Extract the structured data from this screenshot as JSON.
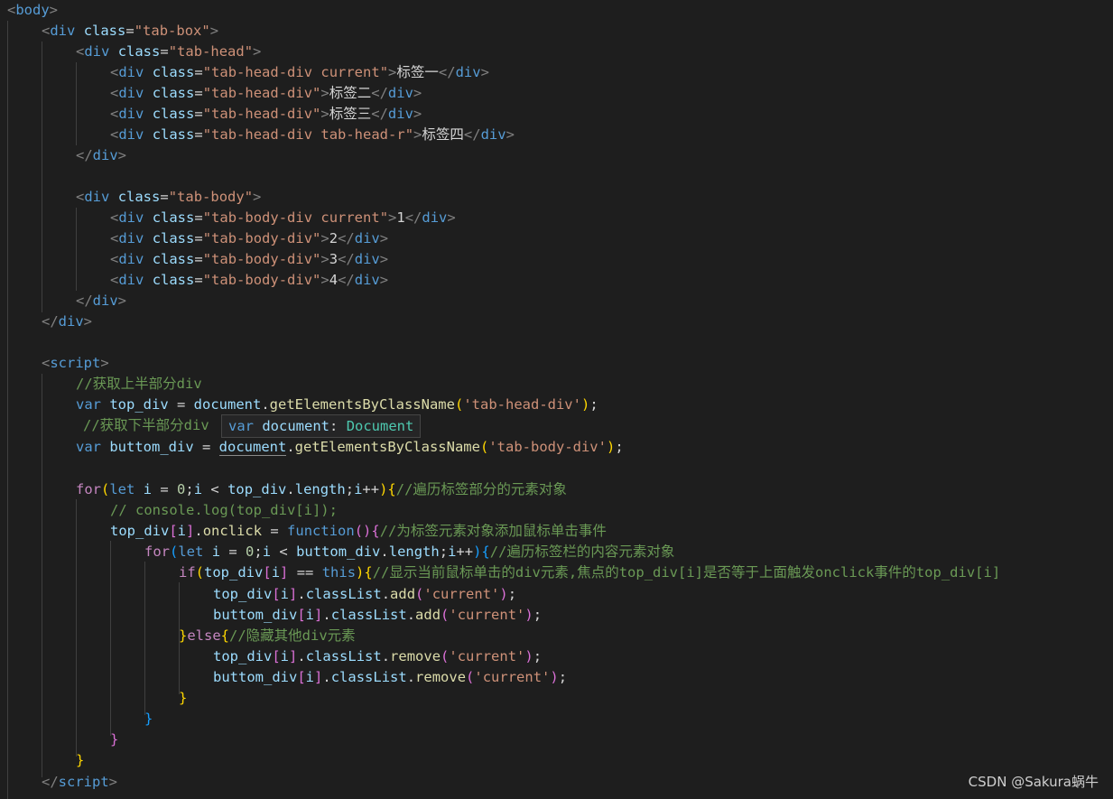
{
  "watermark": "CSDN @Sakura蜗牛",
  "hover": {
    "keyword": "var",
    "name": "document",
    "colon": ":",
    "type": "Document"
  },
  "colors": {
    "background": "#1e1e1e",
    "tag": "#569cd6",
    "attribute": "#9cdcfe",
    "string": "#ce9178",
    "comment": "#6a9955",
    "function": "#dcdcaa",
    "control_keyword": "#c586c0",
    "bracket_level1": "#ffd700",
    "bracket_level2": "#da70d6",
    "bracket_level3": "#179fff"
  },
  "code": {
    "tab_heads": [
      {
        "class_value": "tab-head-div current",
        "text": "标签一"
      },
      {
        "class_value": "tab-head-div",
        "text": "标签二"
      },
      {
        "class_value": "tab-head-div",
        "text": "标签三"
      },
      {
        "class_value": "tab-head-div tab-head-r",
        "text": "标签四"
      }
    ],
    "tab_bodies": [
      {
        "class_value": "tab-body-div current",
        "text": "1"
      },
      {
        "class_value": "tab-body-div",
        "text": "2"
      },
      {
        "class_value": "tab-body-div",
        "text": "3"
      },
      {
        "class_value": "tab-body-div",
        "text": "4"
      }
    ],
    "comments": {
      "get_top": "//获取上半部分div",
      "get_bottom": "//获取下半部分div",
      "loop_tabs": "//遍历标签部分的元素对象",
      "console": "// console.log(top_div[i]);",
      "add_click": "//为标签元素对象添加鼠标单击事件",
      "loop_contents": "//遍历标签栏的内容元素对象",
      "show_current": "//显示当前鼠标单击的div元素,焦点的top_div[i]是否等于上面触发onclick事件的top_div[i]",
      "hide_others": "//隐藏其他div元素"
    },
    "strings": {
      "tab_head_div": "'tab-head-div'",
      "tab_body_div": "'tab-body-div'",
      "current": "'current'"
    }
  }
}
